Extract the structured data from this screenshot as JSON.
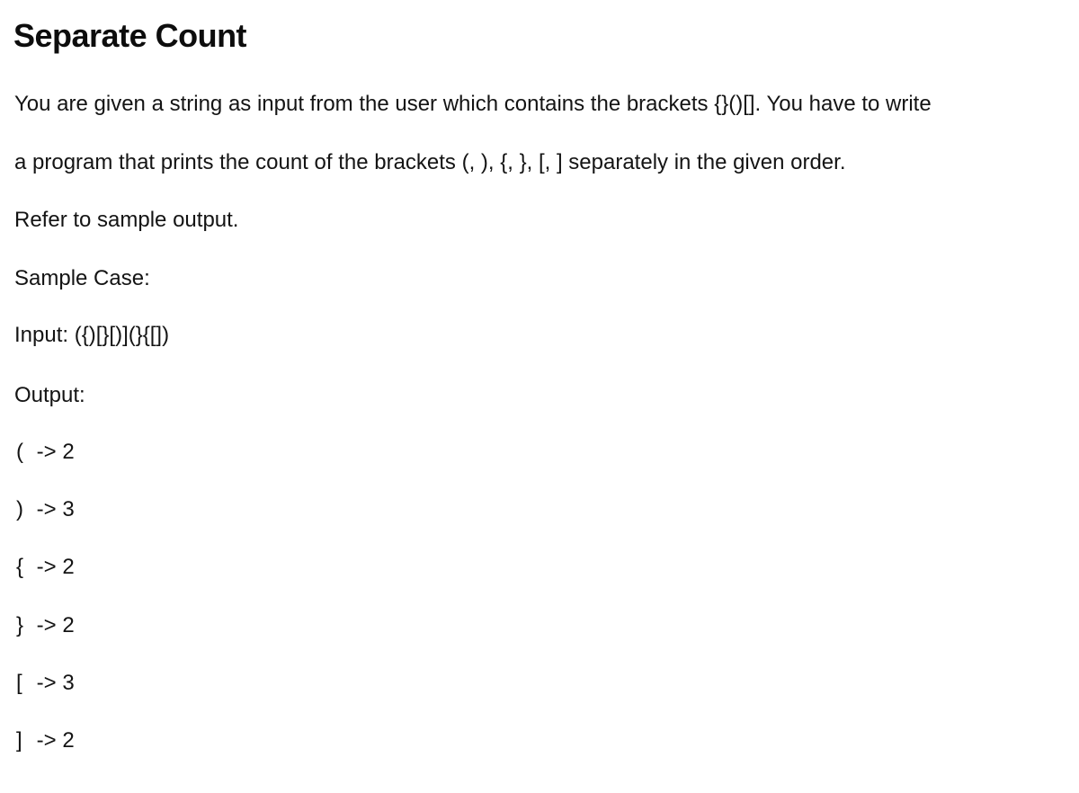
{
  "title": "Separate Count",
  "description": {
    "line1": "You are given a string as input from the user which contains the brackets {}()[]. You have to write",
    "line2": "a program that prints the count of the brackets (, ), {, }, [, ] separately in the given order.",
    "line3": "Refer to sample output."
  },
  "sample": {
    "heading": "Sample Case:",
    "input_label": "Input:",
    "input_value": "({)[}[)](}{[])",
    "output_label": "Output:",
    "outputs": [
      {
        "symbol": "(",
        "arrow": "->",
        "count": "2"
      },
      {
        "symbol": ")",
        "arrow": "->",
        "count": "3"
      },
      {
        "symbol": "{",
        "arrow": "->",
        "count": "2"
      },
      {
        "symbol": "}",
        "arrow": "->",
        "count": "2"
      },
      {
        "symbol": "[",
        "arrow": "->",
        "count": "3"
      },
      {
        "symbol": "]",
        "arrow": "->",
        "count": "2"
      }
    ]
  }
}
